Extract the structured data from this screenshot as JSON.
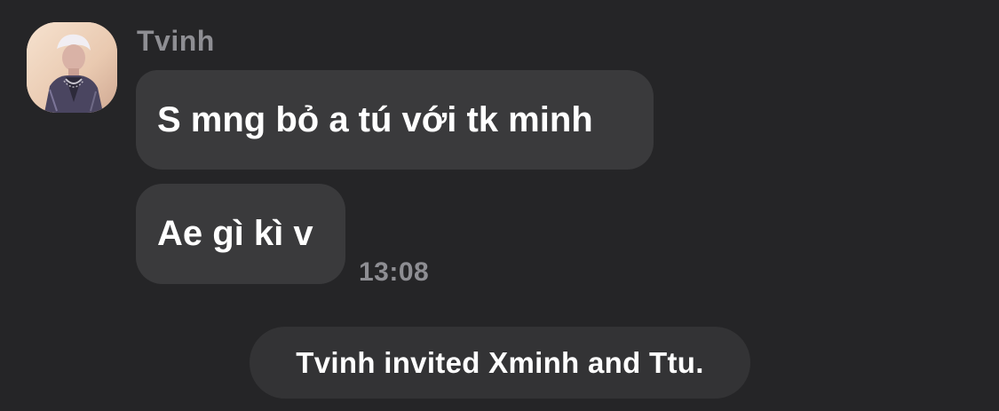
{
  "chat": {
    "sender": {
      "name": "Tvinh",
      "avatar": "user-avatar-photo"
    },
    "messages": [
      {
        "text": "S mng bỏ a tú với tk minh"
      },
      {
        "text": "Ae gì kì v",
        "time": "13:08"
      }
    ],
    "system_notice": "Tvinh invited Xminh and Ttu."
  },
  "colors": {
    "background": "#252527",
    "bubble": "#3a3a3c",
    "muted_text": "#8e8e93",
    "text": "#ffffff"
  }
}
